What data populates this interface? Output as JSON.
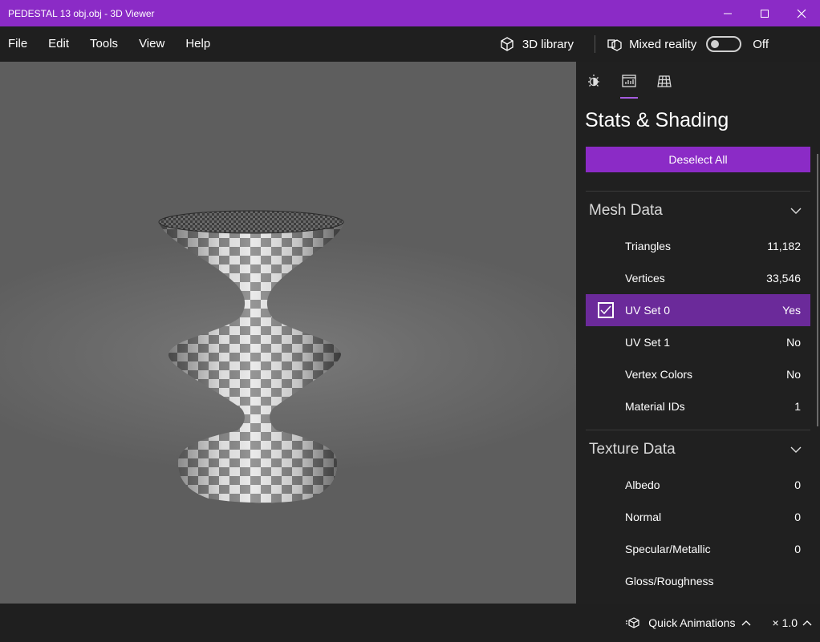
{
  "window": {
    "title": "PEDESTAL 13 obj.obj - 3D Viewer"
  },
  "menu": {
    "items": [
      "File",
      "Edit",
      "Tools",
      "View",
      "Help"
    ],
    "library_label": "3D library",
    "mixed_reality_label": "Mixed reality",
    "mixed_reality_state": "Off"
  },
  "panel": {
    "title": "Stats & Shading",
    "deselect_label": "Deselect All",
    "mesh": {
      "heading": "Mesh Data",
      "rows": [
        {
          "label": "Triangles",
          "value": "11,182"
        },
        {
          "label": "Vertices",
          "value": "33,546"
        },
        {
          "label": "UV Set 0",
          "value": "Yes"
        },
        {
          "label": "UV Set 1",
          "value": "No"
        },
        {
          "label": "Vertex Colors",
          "value": "No"
        },
        {
          "label": "Material IDs",
          "value": "1"
        }
      ]
    },
    "texture": {
      "heading": "Texture Data",
      "rows": [
        {
          "label": "Albedo",
          "value": "0"
        },
        {
          "label": "Normal",
          "value": "0"
        },
        {
          "label": "Specular/Metallic",
          "value": "0"
        },
        {
          "label": "Gloss/Roughness",
          "value": ""
        }
      ]
    }
  },
  "bottom": {
    "animations_label": "Quick Animations",
    "speed_label": "× 1.0"
  },
  "colors": {
    "accent": "#8b2bc6",
    "selected_row": "#6b2a9a"
  }
}
